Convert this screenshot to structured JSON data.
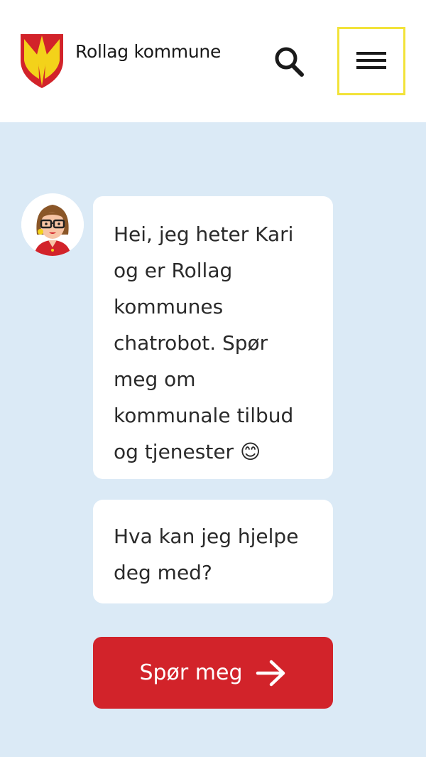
{
  "header": {
    "brand_name": "Rollag kommune",
    "logo_icon": "coat-of-arms-icon",
    "search_icon": "search-icon",
    "menu_icon": "hamburger-menu-icon"
  },
  "chat": {
    "avatar_icon": "chatbot-kari-avatar",
    "messages": [
      "Hei, jeg heter Kari og er Rollag kommunes chatrobot. Spør meg om kommunale tilbud og tjenester 😊",
      "Hva kan jeg hjelpe deg med?"
    ],
    "cta_label": "Spør meg",
    "cta_icon": "arrow-right-icon"
  },
  "colors": {
    "background": "#dbeaf6",
    "accent": "#d2232a",
    "focus_outline": "#f2e33a",
    "shield_yellow": "#f3d21a"
  }
}
